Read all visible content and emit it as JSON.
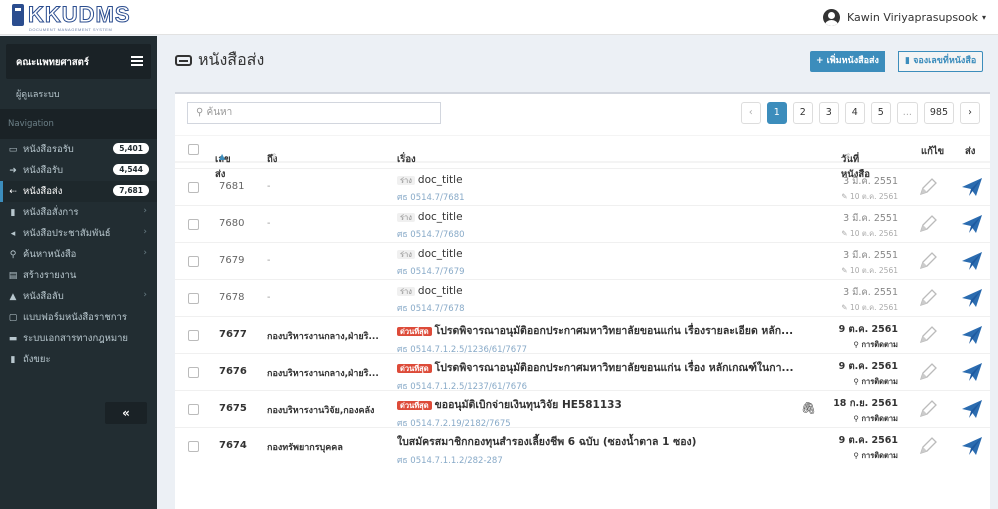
{
  "header": {
    "logo_text": "KKUDMS",
    "logo_sub": "DOCUMENT MANAGEMENT SYSTEM",
    "user_name": "Kawin Viriyaprasupsook"
  },
  "sidebar": {
    "department": "คณะแพทยศาสตร์",
    "role": "ผู้ดูแลระบบ",
    "nav_label": "Navigation",
    "items": [
      {
        "label": "หนังสือรอรับ",
        "badge": "5,401",
        "icon": "inbox-icon"
      },
      {
        "label": "หนังสือรับ",
        "badge": "4,544",
        "icon": "sign-in-icon"
      },
      {
        "label": "หนังสือส่ง",
        "badge": "7,681",
        "icon": "sign-out-icon"
      },
      {
        "label": "หนังสือสั่งการ",
        "icon": "file-icon"
      },
      {
        "label": "หนังสือประชาสัมพันธ์",
        "icon": "bullhorn-icon"
      },
      {
        "label": "ค้นหาหนังสือ",
        "icon": "search-icon"
      },
      {
        "label": "สร้างรายงาน",
        "icon": "report-icon"
      },
      {
        "label": "หนังสือลับ",
        "icon": "lock-icon"
      },
      {
        "label": "แบบฟอร์มหนังสือราชการ",
        "icon": "form-icon"
      },
      {
        "label": "ระบบเอกสารทางกฎหมาย",
        "icon": "id-card-icon"
      },
      {
        "label": "ถังขยะ",
        "icon": "trash-icon"
      }
    ],
    "collapse_label": "«"
  },
  "main": {
    "title": "หนังสือส่ง",
    "add_button": "+ เพิ่มหนังสือส่ง",
    "reserve_button": "จองเลขที่หนังสือ",
    "search_placeholder": "ค้นหา",
    "pagination": [
      "‹",
      "1",
      "2",
      "3",
      "4",
      "5",
      "...",
      "985",
      "›"
    ],
    "columns": {
      "number": "เลขส่ง",
      "to": "ถึง",
      "subject": "เรื่อง",
      "date": "วันที่หนังสือ",
      "edit": "แก้ไข",
      "send": "ส่ง"
    },
    "rows": [
      {
        "number": "7681",
        "to": "-",
        "tag": "ร่าง",
        "subject": "doc_title",
        "ref": "ศธ 0514.7/7681",
        "date": "3 มี.ค. 2551",
        "date_sub": "10 ต.ค. 2561"
      },
      {
        "number": "7680",
        "to": "-",
        "tag": "ร่าง",
        "subject": "doc_title",
        "ref": "ศธ 0514.7/7680",
        "date": "3 มี.ค. 2551",
        "date_sub": "10 ต.ค. 2561"
      },
      {
        "number": "7679",
        "to": "-",
        "tag": "ร่าง",
        "subject": "doc_title",
        "ref": "ศธ 0514.7/7679",
        "date": "3 มี.ค. 2551",
        "date_sub": "10 ต.ค. 2561"
      },
      {
        "number": "7678",
        "to": "-",
        "tag": "ร่าง",
        "subject": "doc_title",
        "ref": "ศธ 0514.7/7678",
        "date": "3 มี.ค. 2551",
        "date_sub": "10 ต.ค. 2561"
      },
      {
        "number": "7677",
        "to": "กองบริหารงานกลาง,ฝ่ายริ...",
        "tag": "ด่วนที่สุด",
        "subject": "โปรดพิจารณาอนุมัติออกประกาศมหาวิทยาลัยขอนแก่น เรื่องรายละเอียด หลัก...",
        "ref": "ศธ 0514.7.1.2.5/1236/61/7677",
        "date": "9 ต.ค. 2561",
        "date_sub": "การติดตาม"
      },
      {
        "number": "7676",
        "to": "กองบริหารงานกลาง,ฝ่ายริ...",
        "tag": "ด่วนที่สุด",
        "subject": "โปรดพิจารณาอนุมัติออกประกาศมหาวิทยาลัยขอนแก่น เรื่อง หลักเกณฑ์ในกา...",
        "ref": "ศธ 0514.7.1.2.5/1237/61/7676",
        "date": "9 ต.ค. 2561",
        "date_sub": "การติดตาม"
      },
      {
        "number": "7675",
        "to": "กองบริหารงานวิจัย,กองคลัง",
        "tag": "ด่วนที่สุด",
        "subject": "ขออนุมัติเบิกจ่ายเงินทุนวิจัย HE581133",
        "ref": "ศธ 0514.7.2.19/2182/7675",
        "date": "18 ก.ย. 2561",
        "date_sub": "การติดตาม"
      },
      {
        "number": "7674",
        "to": "กองทรัพยากรบุคคล",
        "tag": "",
        "subject": "ใบสมัครสมาชิกกองทุนสำรองเลี้ยงชีพ 6 ฉบับ (ซองน้ำตาล 1 ซอง)",
        "ref": "ศธ 0514.7.1.1.2/282-287",
        "date": "9 ต.ค. 2561",
        "date_sub": "การติดตาม"
      }
    ]
  },
  "colors": {
    "accent": "#3c8dbc",
    "sidebar": "#222d32",
    "urgent": "#dd4b39"
  }
}
